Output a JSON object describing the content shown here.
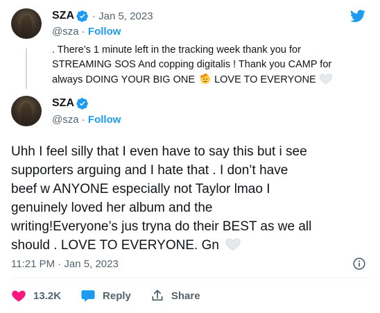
{
  "parent_tweet": {
    "name": "SZA",
    "date": "Jan 5, 2023",
    "handle": "@sza",
    "follow_label": "Follow",
    "text_lines": [
      ". There’s 1 minute left in the tracking week thank you for",
      "STREAMING SOS And copping digitalis ! Thank you CAMP for",
      "always DOING YOUR BIG ONE"
    ],
    "text_tail": "LOVE TO EVERYONE"
  },
  "main_tweet": {
    "name": "SZA",
    "handle": "@sza",
    "follow_label": "Follow",
    "text_lines": [
      "Uhh I feel silly that I even have to say this but i see",
      "supporters arguing and I hate that . I don’t have",
      "beef w ANYONE especially not Taylor lmao I",
      "genuinely loved her album and the",
      "writing!Everyone’s jus tryna do their BEST as we all",
      "should . LOVE TO EVERYONE. Gn"
    ],
    "timestamp": "11:21 PM · Jan 5, 2023"
  },
  "actions": {
    "likes": "13.2K",
    "reply_label": "Reply",
    "share_label": "Share"
  },
  "colors": {
    "brand_blue": "#1d9bf0",
    "like_red": "#f91880",
    "muted": "#536471"
  }
}
